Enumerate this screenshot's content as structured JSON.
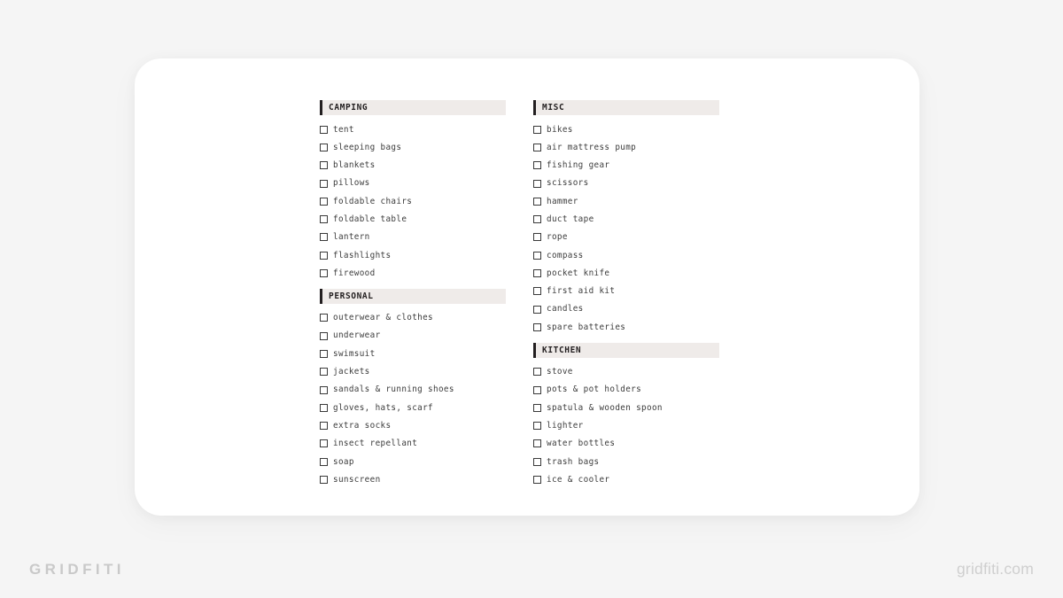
{
  "page": {
    "background_color": "#f5f5f5",
    "card_background": "#ffffff"
  },
  "theme": {
    "header_bar_color": "#efebe9",
    "header_accent_color": "#231f20",
    "item_text_color": "#3c3c3c",
    "checkbox_border_color": "#3a3a3a",
    "brand_color": "#c9c9c9"
  },
  "columns": [
    {
      "name": "left-column",
      "sections": [
        {
          "title": "CAMPING",
          "items": [
            "tent",
            "sleeping bags",
            "blankets",
            "pillows",
            "foldable chairs",
            "foldable table",
            "lantern",
            "flashlights",
            "firewood"
          ]
        },
        {
          "title": "PERSONAL",
          "items": [
            "outerwear & clothes",
            "underwear",
            "swimsuit",
            "jackets",
            "sandals & running shoes",
            "gloves, hats, scarf",
            "extra socks",
            "insect repellant",
            "soap",
            "sunscreen"
          ]
        }
      ]
    },
    {
      "name": "right-column",
      "sections": [
        {
          "title": "MISC",
          "items": [
            "bikes",
            "air mattress pump",
            "fishing gear",
            "scissors",
            "hammer",
            "duct tape",
            "rope",
            "compass",
            "pocket knife",
            "first aid kit",
            "candles",
            "spare batteries"
          ]
        },
        {
          "title": "KITCHEN",
          "items": [
            "stove",
            "pots & pot holders",
            "spatula & wooden spoon",
            "lighter",
            "water bottles",
            "trash bags",
            "ice & cooler"
          ]
        }
      ]
    }
  ],
  "branding": {
    "logo_text": "GRIDFITI",
    "website_text": "gridfiti.com"
  }
}
